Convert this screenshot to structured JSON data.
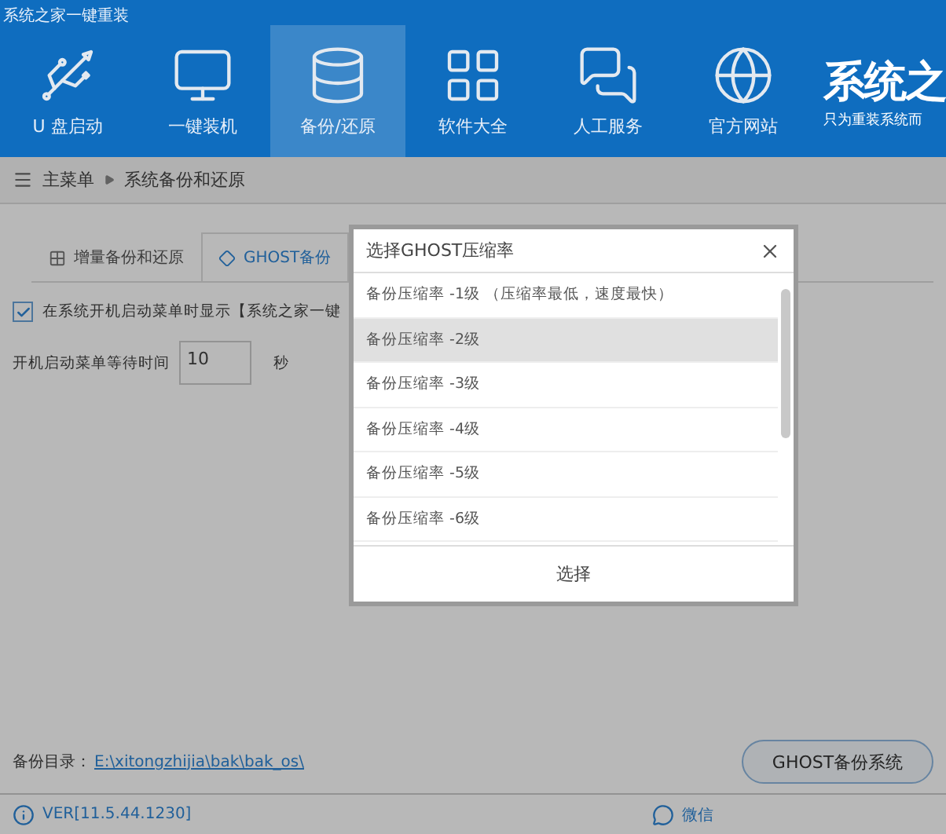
{
  "window": {
    "title": "系统之家一键重装"
  },
  "nav": [
    {
      "label": "U 盘启动",
      "selected": false
    },
    {
      "label": "一键装机",
      "selected": false
    },
    {
      "label": "备份/还原",
      "selected": true
    },
    {
      "label": "软件大全",
      "selected": false
    },
    {
      "label": "人工服务",
      "selected": false
    },
    {
      "label": "官方网站",
      "selected": false
    }
  ],
  "logo": {
    "title": "系统之",
    "subtitle": "只为重装系统而"
  },
  "breadcrumb": [
    "主菜单",
    "系统备份和还原"
  ],
  "tabs": [
    {
      "label": "增量备份和还原",
      "selected": false
    },
    {
      "label": "GHOST备份",
      "selected": true
    }
  ],
  "boot_menu_option": {
    "label": "在系统开机启动菜单时显示【系统之家一键",
    "checked": true
  },
  "wait_time": {
    "label": "开机启动菜单等待时间",
    "value": "10",
    "unit": "秒"
  },
  "backup_dir": {
    "label": "备份目录：",
    "path": "E:\\xitongzhijia\\bak\\bak_os\\"
  },
  "ghost_button": "GHOST备份系统",
  "status_bar": {
    "version": "VER[11.5.44.1230]",
    "wechat": "微信"
  },
  "dialog": {
    "title": "选择GHOST压缩率",
    "options": [
      {
        "label": "备份压缩率 -1级 （压缩率最低，速度最快）",
        "selected": false
      },
      {
        "label": "备份压缩率 -2级",
        "selected": true
      },
      {
        "label": "备份压缩率 -3级",
        "selected": false
      },
      {
        "label": "备份压缩率 -4级",
        "selected": false
      },
      {
        "label": "备份压缩率 -5级",
        "selected": false
      },
      {
        "label": "备份压缩率 -6级",
        "selected": false
      }
    ],
    "confirm": "选择"
  }
}
